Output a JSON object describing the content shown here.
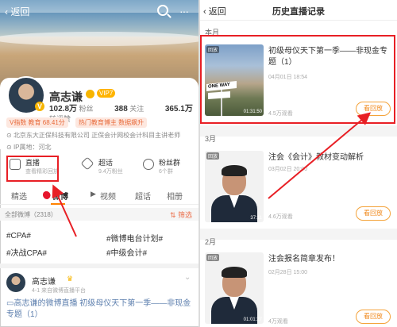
{
  "left": {
    "back_label": "返回",
    "profile": {
      "name": "高志谦",
      "vip_label": "VIP7",
      "fans_count": "102.8万",
      "fans_label": "粉丝",
      "follow_count": "388",
      "follow_label": "关注",
      "reposts_count": "365.1万",
      "reposts_label": "转评赞"
    },
    "tags": [
      "V指数 教育 68.41分",
      "热门教育博主 数据飙升"
    ],
    "info_company": "北京东大正保科技有限公司 正保会计网校会计科目主讲老师",
    "info_ip": "IP属地：河北",
    "features": [
      {
        "title": "直播",
        "subtitle": "查看精彩回放"
      },
      {
        "title": "超话",
        "subtitle": "9.4万粉丝"
      },
      {
        "title": "粉丝群",
        "subtitle": "6个群"
      }
    ],
    "tabs": [
      "精选",
      "微博",
      "视频",
      "超话",
      "相册"
    ],
    "filter": {
      "all_label": "全部微博（2318）",
      "filter_label": "筛选"
    },
    "hashtags": [
      "#CPA#",
      "#微博电台计划#",
      "#决战CPA#",
      "#中级会计#"
    ],
    "post": {
      "author": "高志谦",
      "meta": "4-1 来自微博直播平台",
      "text_link": "高志谦的微博直播",
      "text_body": "初级母仪天下第一季——非现金专题（1）"
    }
  },
  "right": {
    "back_label": "返回",
    "title": "历史直播记录",
    "sections": [
      {
        "label": "本月",
        "record": {
          "badge": "回放",
          "title": "初级母仪天下第一季——非现金专题（1）",
          "date": "04月01日 18:54",
          "views": "4.5万观看",
          "duration": "01:31:50",
          "replay": "看回放",
          "sign_text": "ONE WAY"
        }
      },
      {
        "label": "3月",
        "record": {
          "badge": "回放",
          "title": "注会《会计》教材变动解析",
          "date": "03月02日 20:00",
          "views": "4.6万观看",
          "duration": "37:11",
          "replay": "看回放"
        }
      },
      {
        "label": "2月",
        "record": {
          "badge": "回放",
          "title": "注会报名简章发布！",
          "date": "02月28日 15:00",
          "views": "4万观看",
          "duration": "01:01:27",
          "replay": "看回放"
        }
      }
    ]
  },
  "colors": {
    "accent_orange": "#f08a1e",
    "highlight_red": "#e81f25",
    "link_blue": "#5d7fae"
  }
}
